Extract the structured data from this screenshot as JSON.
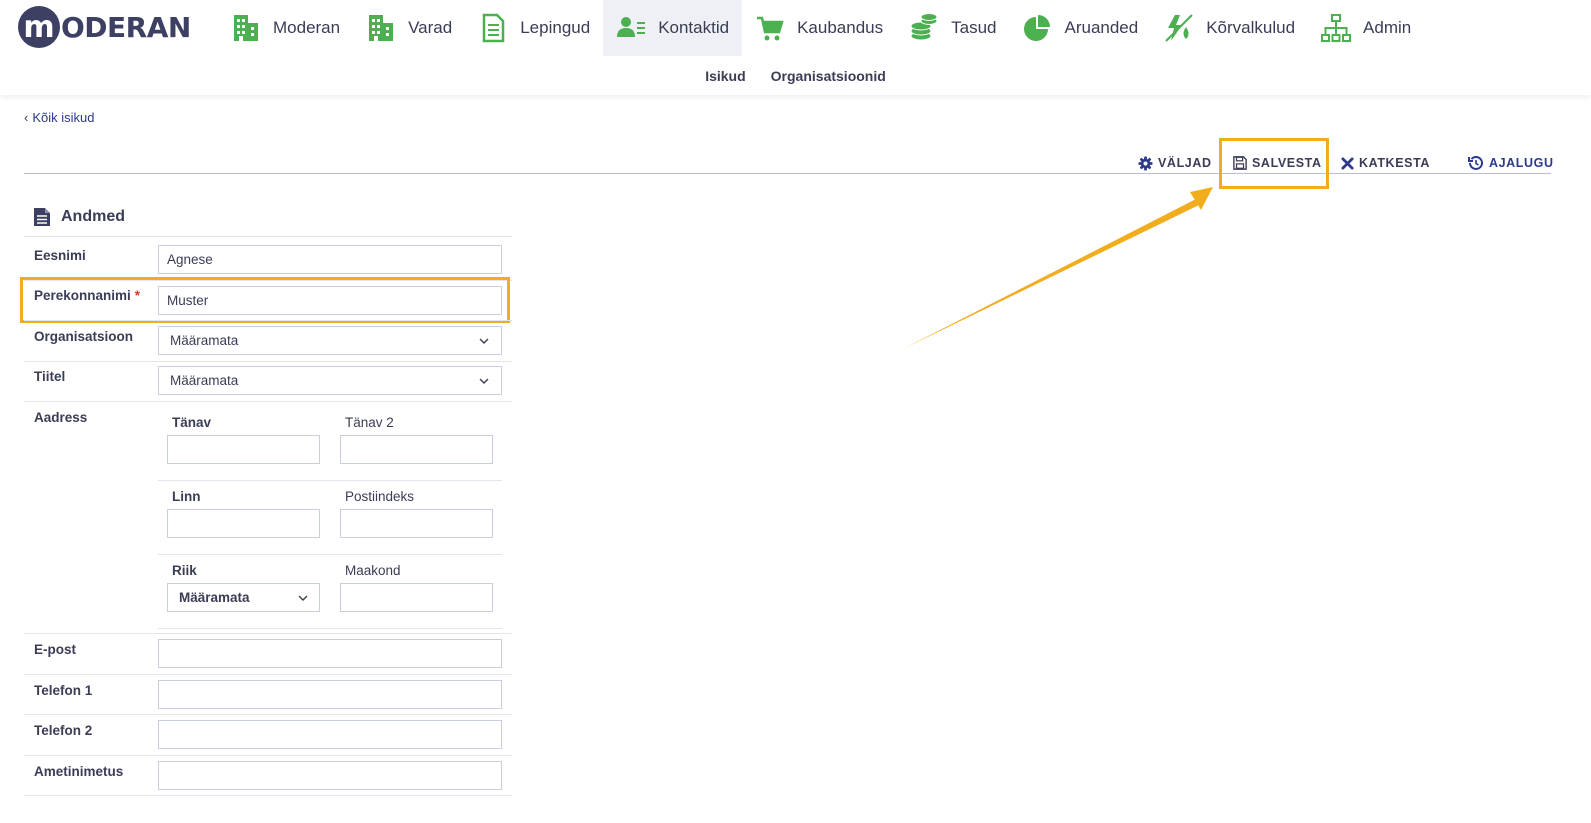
{
  "logo": {
    "letter": "m",
    "text": "ODERAN"
  },
  "nav": [
    {
      "label": "Moderan",
      "icon": "building-icon"
    },
    {
      "label": "Varad",
      "icon": "building-icon"
    },
    {
      "label": "Lepingud",
      "icon": "document-icon"
    },
    {
      "label": "Kontaktid",
      "icon": "contact-card-icon",
      "active": true
    },
    {
      "label": "Kaubandus",
      "icon": "cart-icon"
    },
    {
      "label": "Tasud",
      "icon": "coins-icon"
    },
    {
      "label": "Aruanded",
      "icon": "pie-chart-icon"
    },
    {
      "label": "Kõrvalkulud",
      "icon": "utilities-icon"
    },
    {
      "label": "Admin",
      "icon": "org-chart-icon"
    }
  ],
  "subnav": [
    "Isikud",
    "Organisatsioonid"
  ],
  "back_link": "Kõik isikud",
  "toolbar": {
    "fields": "VÄLJAD",
    "save": "SALVESTA",
    "cancel": "KATKESTA",
    "history": "AJALUGU"
  },
  "section_title": "Andmed",
  "form": {
    "first_name": {
      "label": "Eesnimi",
      "value": "Agnese"
    },
    "last_name": {
      "label": "Perekonnanimi",
      "required_mark": "*",
      "value": "Muster"
    },
    "organization": {
      "label": "Organisatsioon",
      "value": "Määramata"
    },
    "title": {
      "label": "Tiitel",
      "value": "Määramata"
    },
    "address": {
      "label": "Aadress",
      "street": "Tänav",
      "street2": "Tänav 2",
      "city": "Linn",
      "postal": "Postiindeks",
      "country": "Riik",
      "country_value": "Määramata",
      "county": "Maakond"
    },
    "email": {
      "label": "E-post",
      "value": ""
    },
    "phone1": {
      "label": "Telefon 1",
      "value": ""
    },
    "phone2": {
      "label": "Telefon 2",
      "value": ""
    },
    "job_title": {
      "label": "Ametinimetus",
      "value": ""
    }
  },
  "colors": {
    "accent_green": "#4caf50",
    "brand": "#3d3f63",
    "link": "#2d3a8c",
    "highlight": "#f2ad1d"
  }
}
